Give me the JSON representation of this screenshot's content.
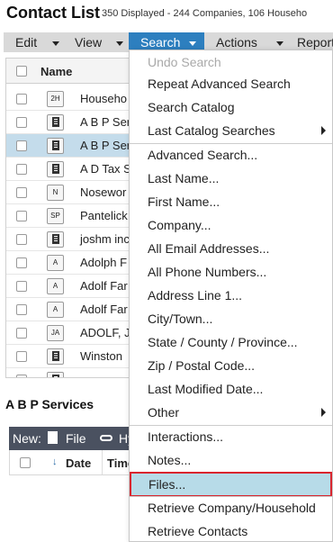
{
  "header": {
    "title": "Contact List",
    "subtitle": "350 Displayed - 244 Companies, 106 Househo"
  },
  "menubar": {
    "items": [
      {
        "label": "Edit"
      },
      {
        "label": "View"
      },
      {
        "label": "Search"
      },
      {
        "label": "Actions"
      },
      {
        "label": "Report"
      }
    ]
  },
  "grid": {
    "column_name": "Name",
    "rows": [
      {
        "type": "2H",
        "icon": "household-badge",
        "label": "Househo"
      },
      {
        "type": "",
        "icon": "building-icon",
        "label": "A B P Ser"
      },
      {
        "type": "",
        "icon": "building-icon",
        "label": "A B P Ser"
      },
      {
        "type": "",
        "icon": "building-icon",
        "label": "A D Tax S"
      },
      {
        "type": "N",
        "icon": "initials-badge",
        "label": "Nosewor"
      },
      {
        "type": "SP",
        "icon": "initials-badge",
        "label": "Pantelick"
      },
      {
        "type": "",
        "icon": "building-icon",
        "label": "joshm inc"
      },
      {
        "type": "A",
        "icon": "initials-badge",
        "label": "Adolph F"
      },
      {
        "type": "A",
        "icon": "initials-badge",
        "label": "Adolf Far"
      },
      {
        "type": "A",
        "icon": "initials-badge",
        "label": "Adolf Far"
      },
      {
        "type": "JA",
        "icon": "initials-badge",
        "label": "ADOLF, J"
      },
      {
        "type": "",
        "icon": "building-icon",
        "label": "Winston"
      },
      {
        "type": "",
        "icon": "building-icon",
        "label": ""
      }
    ]
  },
  "detail": {
    "section_title": "A B P Services",
    "toolbar": {
      "new_label": "New:",
      "file_label": "File",
      "hy_label": "Hy"
    },
    "columns": {
      "date": "Date",
      "time": "Time"
    }
  },
  "search_menu": {
    "items": [
      {
        "label": "Undo Search",
        "disabled": true
      },
      {
        "label": "Repeat Advanced Search"
      },
      {
        "label": "Search Catalog"
      },
      {
        "label": "Last Catalog Searches",
        "submenu": true
      },
      {
        "label": "Advanced Search..."
      },
      {
        "label": "Last Name..."
      },
      {
        "label": "First Name..."
      },
      {
        "label": "Company..."
      },
      {
        "label": "All Email Addresses..."
      },
      {
        "label": "All Phone Numbers..."
      },
      {
        "label": "Address Line 1..."
      },
      {
        "label": "City/Town..."
      },
      {
        "label": "State / County / Province..."
      },
      {
        "label": "Zip / Postal Code..."
      },
      {
        "label": "Last Modified Date..."
      },
      {
        "label": "Other",
        "submenu": true
      },
      {
        "label": "Interactions..."
      },
      {
        "label": "Notes..."
      },
      {
        "label": "Files...",
        "highlighted": true
      },
      {
        "label": "Retrieve Company/Household"
      },
      {
        "label": "Retrieve Contacts"
      }
    ]
  },
  "colors": {
    "menubar": "#d9d9d9",
    "active_menu": "#2d7fbf",
    "selected_row": "#c4dceb",
    "highlight_item": "#b7dbe8",
    "highlight_border": "#d9252e",
    "toolbar": "#4a5160"
  }
}
